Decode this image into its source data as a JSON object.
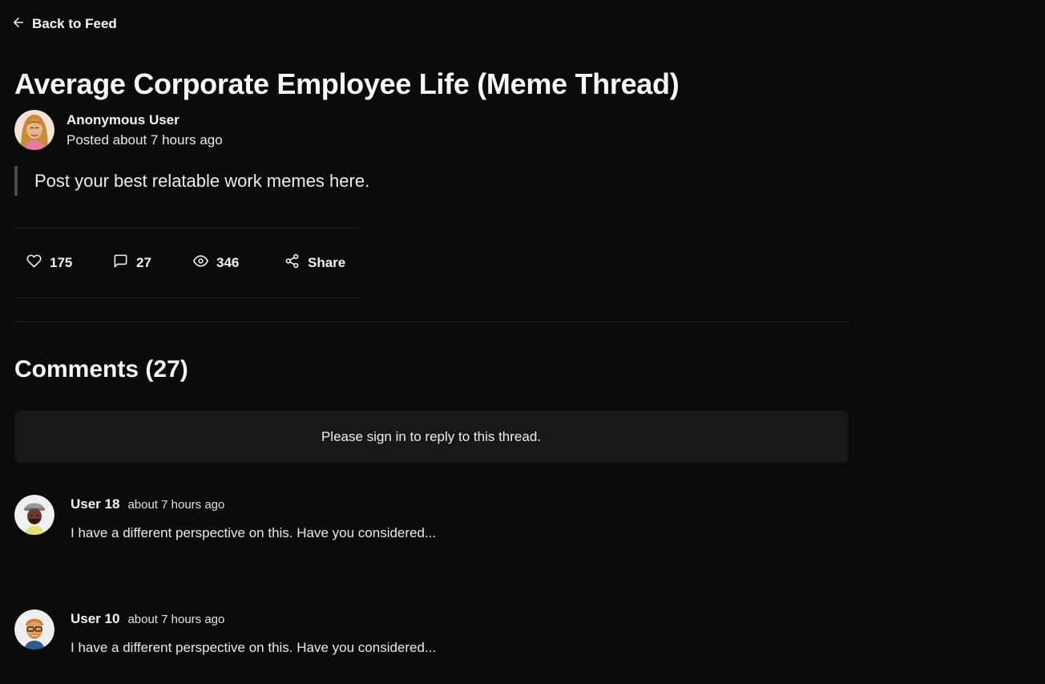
{
  "nav": {
    "back_label": "Back to Feed",
    "back_icon": "arrow-left-icon"
  },
  "post": {
    "title": "Average Corporate Employee Life (Meme Thread)",
    "author": {
      "name": "Anonymous User",
      "posted": "Posted about 7 hours ago",
      "avatar": "avatar-woman-long-hair"
    },
    "body": "Post your best relatable work memes here.",
    "stats": {
      "likes": "175",
      "comments": "27",
      "views": "346",
      "share_label": "Share"
    }
  },
  "comments_section": {
    "heading": "Comments (27)",
    "signin_prompt": "Please sign in to reply to this thread.",
    "items": [
      {
        "user": "User 18",
        "time": "about 7 hours ago",
        "text": "I have a different perspective on this. Have you considered...",
        "avatar": "avatar-man-cap"
      },
      {
        "user": "User 10",
        "time": "about 7 hours ago",
        "text": "I have a different perspective on this. Have you considered...",
        "avatar": "avatar-man-glasses"
      }
    ]
  },
  "colors": {
    "background": "#0b0b0c",
    "card": "#18181b",
    "text": "#f2f2f2",
    "quote_bar": "#4a4a50"
  }
}
